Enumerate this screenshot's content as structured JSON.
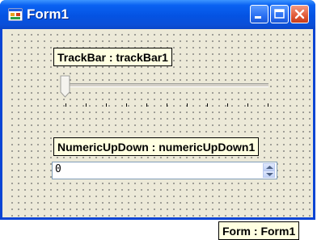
{
  "window": {
    "title": "Form1",
    "buttons": {
      "minimize_icon": "minimize-icon",
      "maximize_icon": "maximize-icon",
      "close_icon": "close-icon"
    }
  },
  "trackbar": {
    "label": "TrackBar : trackBar1",
    "value": 0,
    "minimum": 0,
    "maximum": 10,
    "tick_count": 11
  },
  "numeric": {
    "label": "NumericUpDown : numericUpDown1",
    "value": "0"
  },
  "form_label": "Form : Form1",
  "colors": {
    "titlebar": "#0a62f2",
    "label_background": "#ffffe1",
    "form_background": "#ece9d8"
  }
}
